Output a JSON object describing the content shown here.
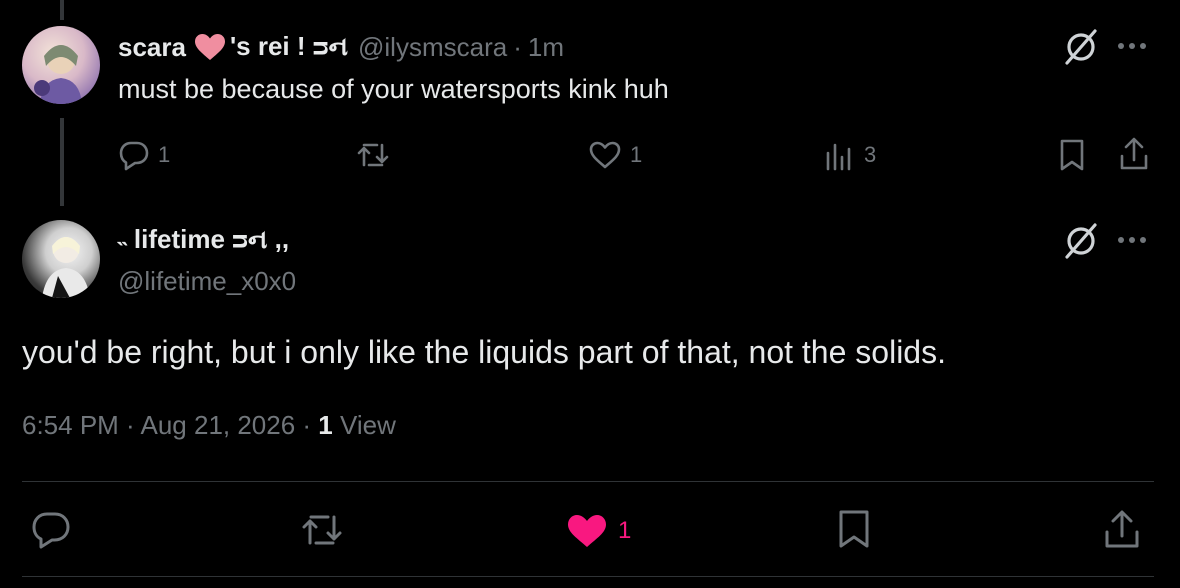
{
  "reply": {
    "display_name_prefix": "scara",
    "display_name_suffix": "'s rei ! ᴝન",
    "handle": "@ilysmscara",
    "separator": "·",
    "time": "1m",
    "text": "must be because of your watersports kink huh",
    "replies": "1",
    "likes": "1",
    "views": "3"
  },
  "main_post": {
    "display_name": "˵ lifetime ᴝન ,,",
    "handle": "@lifetime_x0x0",
    "text": "you'd be right, but i only like the liquids part of that, not the solids.",
    "timestamp": "6:54 PM · Aug 21, 2026 · ",
    "view_count": "1",
    "view_label": "View",
    "likes": "1"
  },
  "colors": {
    "muted": "#71767b",
    "like_pink": "#f91880",
    "grok_icon": "#cfd3d6"
  }
}
